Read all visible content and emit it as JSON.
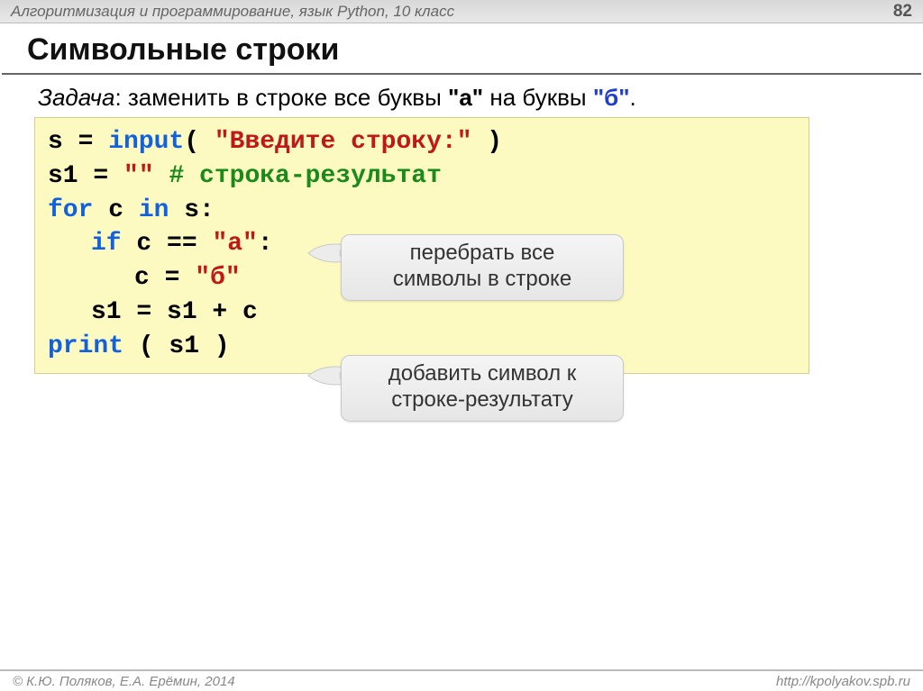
{
  "header": {
    "course": "Алгоритмизация и программирование, язык Python, 10 класс",
    "page": "82"
  },
  "title": "Символьные строки",
  "task": {
    "label": "Задача",
    "text1": ": заменить в строке все буквы ",
    "litA": "\"а\"",
    "text2": " на буквы ",
    "litB": "\"б\"",
    "text3": "."
  },
  "code": {
    "l1_s": "s = ",
    "l1_fn": "input",
    "l1_p1": "( ",
    "l1_str": "\"Введите строку:\"",
    "l1_p2": " )",
    "l2_s": "s1 = ",
    "l2_str": "\"\"",
    "l2_sp": "    ",
    "l2_cmt": "# строка-результат",
    "l3_for": "for",
    "l3_mid": " c ",
    "l3_in": "in",
    "l3_end": " s:",
    "l4_if": "if",
    "l4_mid": " c == ",
    "l4_str": "\"а\"",
    "l4_end": ":",
    "l5_s": "c = ",
    "l5_str": "\"б\"",
    "l6": "s1 = s1 + c",
    "l7_fn": "print",
    "l7_p": " ( s1 )"
  },
  "callouts": {
    "c1_l1": "перебрать все",
    "c1_l2": "символы в строке",
    "c2_l1": "добавить символ к",
    "c2_l2": "строке-результату"
  },
  "footer": {
    "left": "© К.Ю. Поляков, Е.А. Ерёмин, 2014",
    "right": "http://kpolyakov.spb.ru"
  }
}
